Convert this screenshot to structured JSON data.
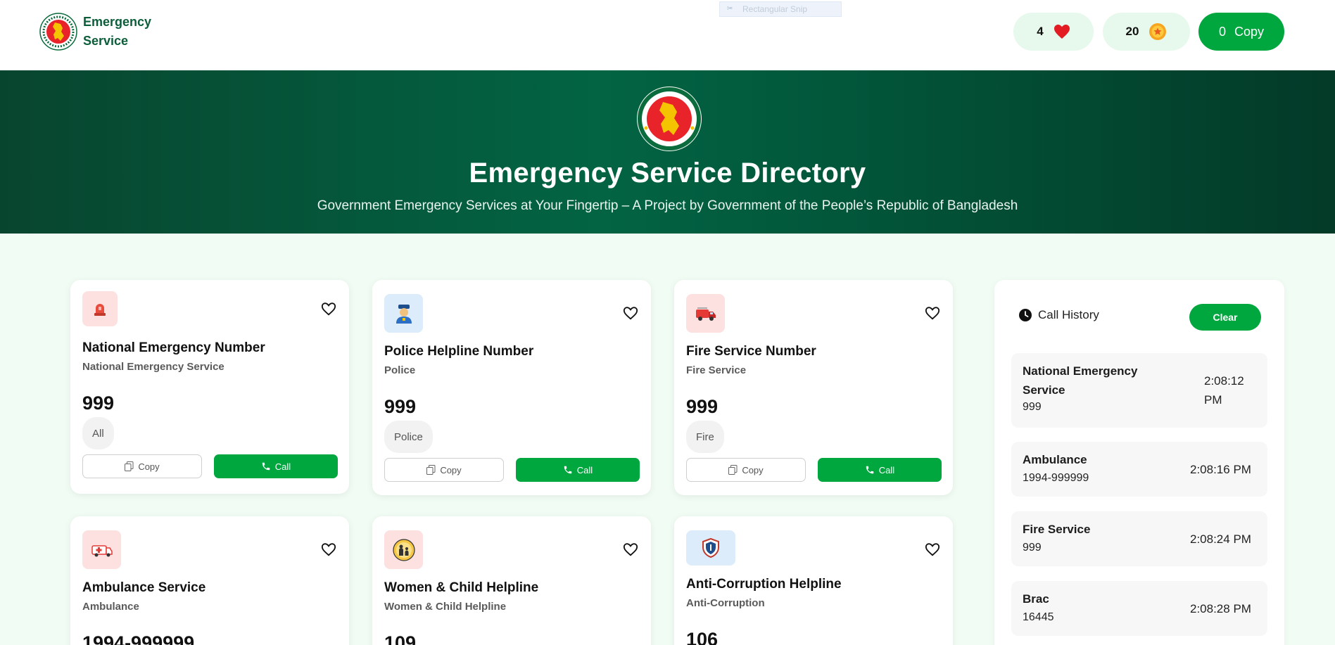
{
  "header": {
    "brand": "Emergency Service",
    "snip_label": "Rectangular Snip",
    "heart_count": "4",
    "coin_count": "20",
    "copy_count": "0",
    "copy_label": "Copy"
  },
  "hero": {
    "title": "Emergency Service Directory",
    "subtitle": "Government Emergency Services at Your Fingertip – A Project by Government of the People’s Republic of Bangladesh"
  },
  "cards": [
    {
      "title": "National Emergency Number",
      "subtitle": "National Emergency Service",
      "number": "999",
      "tag": "All",
      "copy_label": "Copy",
      "call_label": "Call"
    },
    {
      "title": "Police Helpline Number",
      "subtitle": "Police",
      "number": "999",
      "tag": "Police",
      "copy_label": "Copy",
      "call_label": "Call"
    },
    {
      "title": "Fire Service Number",
      "subtitle": "Fire Service",
      "number": "999",
      "tag": "Fire",
      "copy_label": "Copy",
      "call_label": "Call"
    },
    {
      "title": "Ambulance Service",
      "subtitle": "Ambulance",
      "number": "1994-999999"
    },
    {
      "title": "Women & Child Helpline",
      "subtitle": "Women & Child Helpline",
      "number": "109"
    },
    {
      "title": "Anti-Corruption Helpline",
      "subtitle": "Anti-Corruption",
      "number": "106"
    }
  ],
  "history": {
    "title": "Call History",
    "clear_label": "Clear",
    "items": [
      {
        "name": "National Emergency Service",
        "number": "999",
        "time": "2:08:12 PM"
      },
      {
        "name": "Ambulance",
        "number": "1994-999999",
        "time": "2:08:16 PM"
      },
      {
        "name": "Fire Service",
        "number": "999",
        "time": "2:08:24 PM"
      },
      {
        "name": "Brac",
        "number": "16445",
        "time": "2:08:28 PM"
      }
    ]
  },
  "colors": {
    "primary_green": "#00a63e",
    "brand_green": "#0b5e3a",
    "page_bg": "#f1fcf4"
  },
  "icons": [
    "heart-icon",
    "coin-icon",
    "siren-icon",
    "police-icon",
    "fire-truck-icon",
    "ambulance-icon",
    "women-child-icon",
    "anti-corruption-icon",
    "clock-icon",
    "copy-icon",
    "phone-icon"
  ]
}
